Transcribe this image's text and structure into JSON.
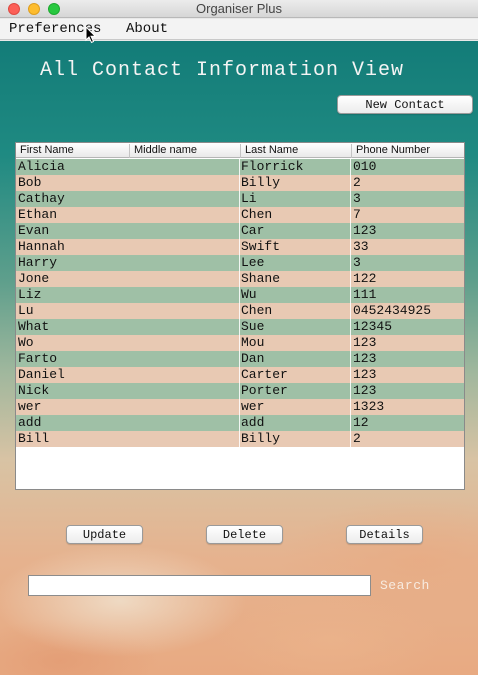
{
  "window": {
    "title": "Organiser Plus"
  },
  "menu": {
    "preferences": "Preferences",
    "about": "About"
  },
  "heading": "All Contact Information View",
  "buttons": {
    "new_contact": "New Contact",
    "update": "Update",
    "delete": "Delete",
    "details": "Details"
  },
  "table": {
    "columns": [
      "First Name",
      "Middle name",
      "Last Name",
      "Phone Number"
    ],
    "rows": [
      [
        "Alicia",
        "",
        "Florrick",
        "010"
      ],
      [
        "Bob",
        "",
        "Billy",
        "2"
      ],
      [
        "Cathay",
        "",
        "Li",
        "3"
      ],
      [
        "Ethan",
        "",
        "Chen",
        "7"
      ],
      [
        "Evan",
        "",
        "Car",
        "123"
      ],
      [
        "Hannah",
        "",
        "Swift",
        "33"
      ],
      [
        "Harry",
        "",
        "Lee",
        "3"
      ],
      [
        "Jone",
        "",
        "Shane",
        "122"
      ],
      [
        "Liz",
        "",
        "Wu",
        "111"
      ],
      [
        "Lu",
        "",
        "Chen",
        "0452434925"
      ],
      [
        "What",
        "",
        "Sue",
        "12345"
      ],
      [
        "Wo",
        "",
        "Mou",
        "123"
      ],
      [
        "Farto",
        "",
        "Dan",
        "123"
      ],
      [
        "Daniel",
        "",
        "Carter",
        "123"
      ],
      [
        "Nick",
        "",
        "Porter",
        "123"
      ],
      [
        "wer",
        "",
        "wer",
        "1323"
      ],
      [
        "add",
        "",
        "add",
        "12"
      ],
      [
        "Bill",
        "",
        "Billy",
        "2"
      ]
    ]
  },
  "search": {
    "value": "",
    "label": "Search"
  },
  "colors": {
    "row_teal": "#9fc0a6",
    "row_peach": "#e8c9b3",
    "background_top": "#137c78",
    "background_bottom": "#e8aa82"
  }
}
